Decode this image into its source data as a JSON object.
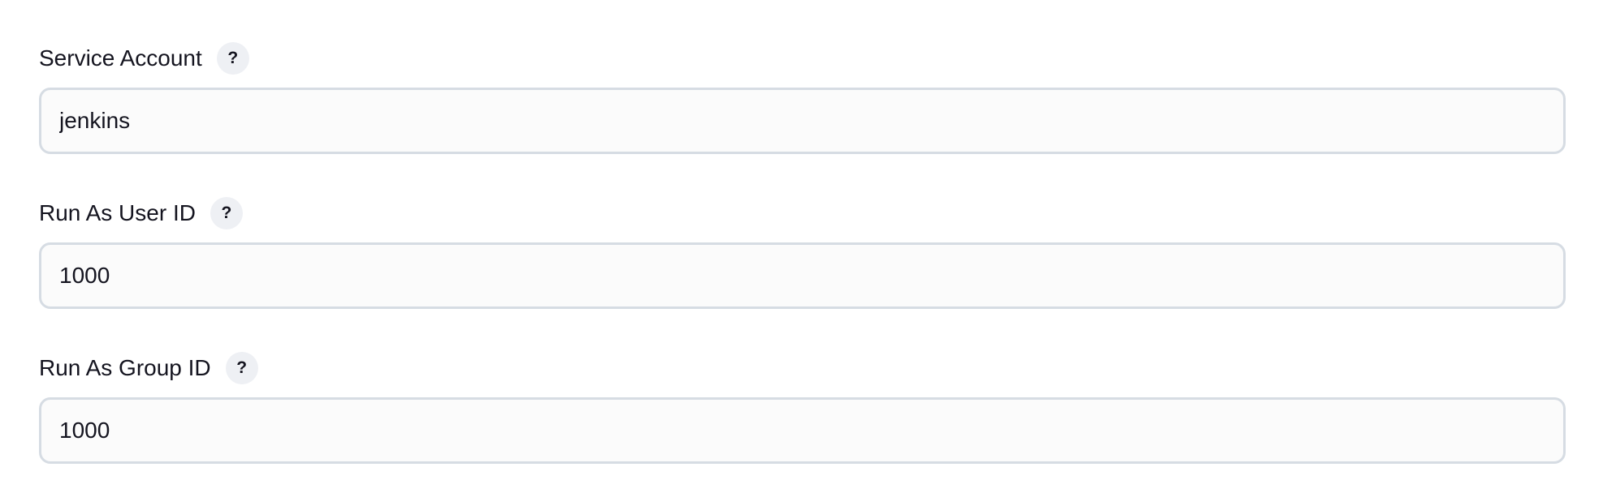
{
  "fields": [
    {
      "label": "Service Account",
      "help_glyph": "?",
      "help_icon": "question-mark-icon",
      "value": "jenkins"
    },
    {
      "label": "Run As User ID",
      "help_glyph": "?",
      "help_icon": "question-mark-icon",
      "value": "1000"
    },
    {
      "label": "Run As Group ID",
      "help_glyph": "?",
      "help_icon": "question-mark-icon",
      "value": "1000"
    }
  ],
  "colors": {
    "text": "#14141f",
    "input_border": "#d6dce3",
    "input_background": "#fbfbfb",
    "help_background": "#eef0f4"
  }
}
